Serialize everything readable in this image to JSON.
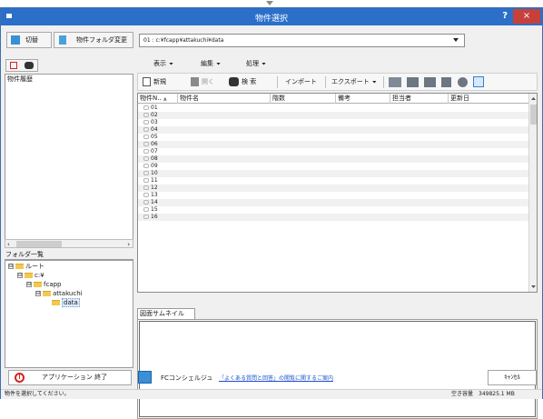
{
  "window": {
    "title": "物件選択",
    "help": "?",
    "close": "×"
  },
  "toolbar1": {
    "switch_label": "切替",
    "change_folder_label": "物件フォルダ変更",
    "path_value": "01 : c:¥fcapp¥attakuchi¥data"
  },
  "left": {
    "history_heading": "物件履歴",
    "folder_heading": "フォルダ一覧",
    "tree": [
      {
        "label": "ルート",
        "exp": "⊟"
      },
      {
        "label": "c:¥",
        "exp": "⊟"
      },
      {
        "label": "fcapp",
        "exp": "⊟"
      },
      {
        "label": "attakuchi",
        "exp": "⊟"
      },
      {
        "label": "data",
        "exp": ""
      }
    ]
  },
  "menus": {
    "view": "表示",
    "edit": "編集",
    "process": "処理"
  },
  "tools": {
    "new": "新規",
    "open": "開く",
    "search": "検 索",
    "import": "インポート",
    "export": "エクスポート"
  },
  "grid": {
    "headers": [
      "物件N..",
      "物件名",
      "階数",
      "備考",
      "担当者",
      "更新日"
    ],
    "sort_indicator": "▲",
    "rows": [
      "01",
      "02",
      "03",
      "04",
      "05",
      "06",
      "07",
      "08",
      "09",
      "10",
      "11",
      "12",
      "13",
      "14",
      "15",
      "16"
    ]
  },
  "thumbnail": {
    "tab": "図面サムネイル"
  },
  "footer": {
    "exit": "アプリケーション 終了",
    "fc_label": "FCコンシェルジュ",
    "link": "「よくある質問と回答」の閲覧に関するご案内",
    "cancel": "ｷｬﾝｾﾙ"
  },
  "status": {
    "message": "物件を選択してください。",
    "free_label": "空き容量",
    "free_value": "349825.1 MB"
  }
}
